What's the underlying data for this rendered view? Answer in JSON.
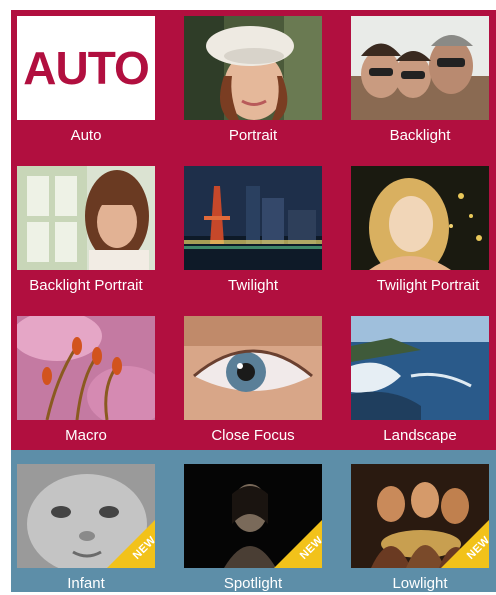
{
  "scenes": [
    {
      "label": "Auto",
      "thumb_text": "AUTO"
    },
    {
      "label": "Portrait"
    },
    {
      "label": "Backlight"
    },
    {
      "label": "Backlight Portrait"
    },
    {
      "label": "Twilight"
    },
    {
      "label": "Twilight Portrait"
    },
    {
      "label": "Macro"
    },
    {
      "label": "Close Focus"
    },
    {
      "label": "Landscape"
    },
    {
      "label": "Infant",
      "badge": "NEW"
    },
    {
      "label": "Spotlight",
      "badge": "NEW"
    },
    {
      "label": "Lowlight",
      "badge": "NEW"
    }
  ],
  "colors": {
    "panel_primary": "#b10f3f",
    "panel_secondary": "#5d8ea8",
    "badge": "#f2c21a"
  }
}
